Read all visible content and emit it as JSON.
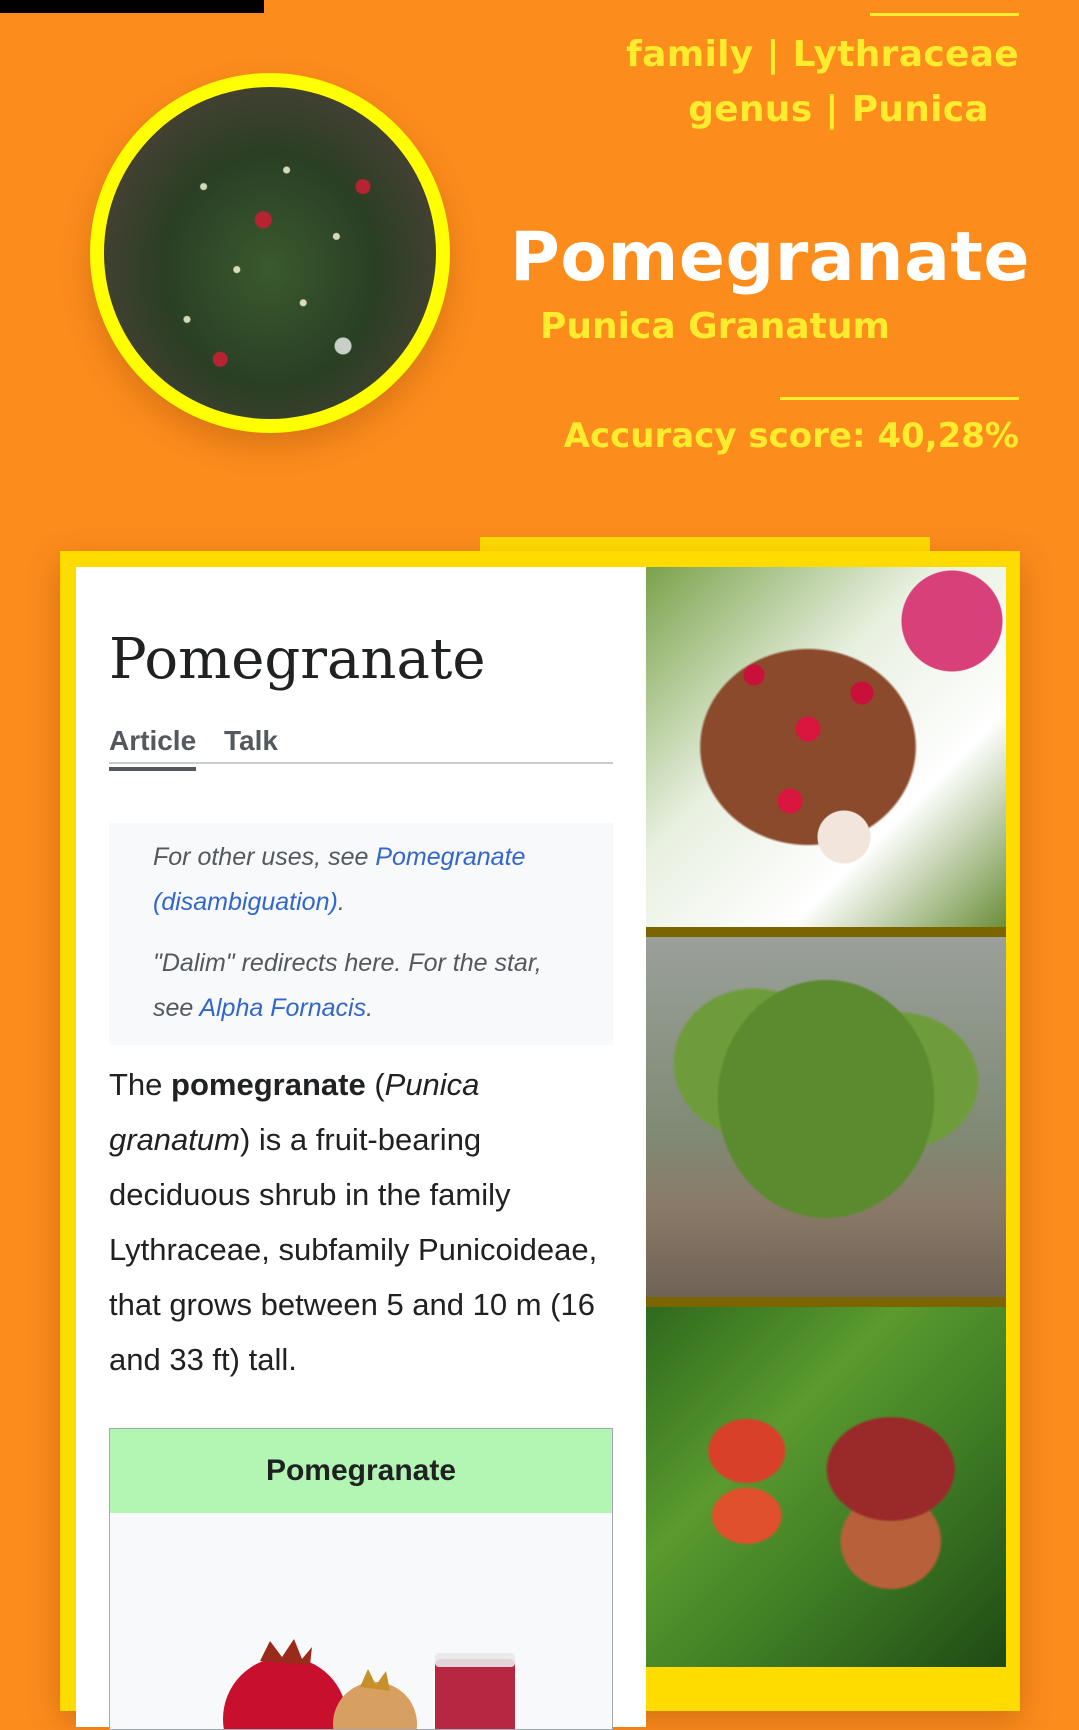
{
  "header": {
    "family": "family | Lythraceae",
    "genus": "genus | Punica",
    "common_name": "Pomegranate",
    "scientific_name": "Punica Granatum",
    "accuracy": "Accuracy score: 40,28%",
    "photo_icon": "christmas-tree-photo"
  },
  "wiki": {
    "title": "Pomegranate",
    "tabs": [
      "Article",
      "Talk"
    ],
    "hatnote": {
      "line1_prefix": "For other uses, see ",
      "line1_link": "Pomegranate (disambiguation)",
      "line1_suffix": ".",
      "line2_prefix": "\"Dalim\" redirects here. For the star, see ",
      "line2_link": "Alpha Fornacis",
      "line2_suffix": "."
    },
    "lead": {
      "t1": "The ",
      "b1": "pomegranate",
      "t2": " (",
      "i1": "Punica granatum",
      "t3": ") is a fruit-bearing deciduous shrub in the family Lythraceae, subfamily Punicoideae, that grows between 5 and 10 m (16 and 33 ft) tall."
    },
    "infobox_title": "Pomegranate"
  },
  "colors": {
    "background": "#fc8c1c",
    "accent_yellow": "#ffec2e",
    "card_yellow": "#ffdc00",
    "link_blue": "#3366cc",
    "infobox_green": "#b3f5b3"
  },
  "gallery": [
    "pomegranate-fruit-open-photo",
    "pomegranate-shrub-photo",
    "pomegranate-flowers-photo"
  ]
}
